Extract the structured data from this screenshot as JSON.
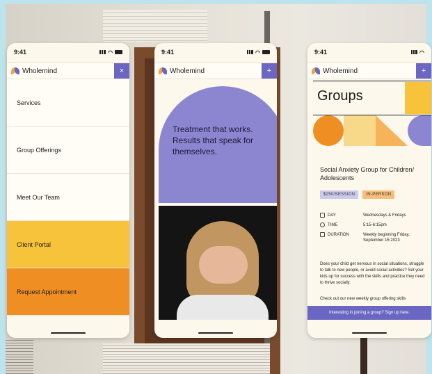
{
  "status": {
    "time": "9:41"
  },
  "brand": {
    "name": "Wholemind"
  },
  "phone1": {
    "menu_close": "×",
    "nav_items": [
      {
        "label": "Services"
      },
      {
        "label": "Group Offerings"
      },
      {
        "label": "Meet Our Team"
      },
      {
        "label": "Client Portal"
      },
      {
        "label": "Request Appointment"
      }
    ]
  },
  "phone2": {
    "menu_open": "+",
    "hero_text": "Treatment that works. Results that speak for themselves."
  },
  "phone3": {
    "menu_open": "+",
    "title": "Groups",
    "subhead": "Social Anxiety Group for Children/ Adolescents",
    "badges": [
      "$250/SESSION",
      "IN-PERSON"
    ],
    "details": [
      {
        "label": "DAY",
        "value": "Wednesdays & Fridays"
      },
      {
        "label": "TIME",
        "value": "5:15-6:15pm"
      },
      {
        "label": "DURATION",
        "value": "Weekly beginning Friday, September 16 2023"
      }
    ],
    "paragraph": "Does your child get nervous in social situations, struggle to talk to new people, or avoid social activities? Set your kids up for success with the skills and practice they need to thrive socially.",
    "paragraph2": "Check out our new weekly group offering skills",
    "cta": "Interesting in joining a group? Sign up here."
  },
  "colors": {
    "purple": "#6a66c2",
    "yellow": "#f6c33b",
    "orange": "#ef8f23",
    "cream": "#fdf8ec"
  }
}
